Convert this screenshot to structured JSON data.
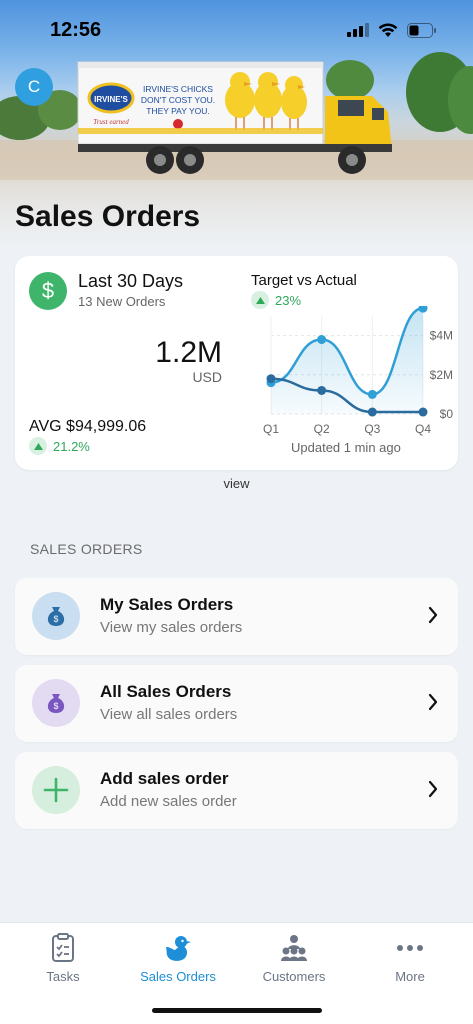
{
  "status_bar": {
    "time": "12:56"
  },
  "header": {
    "avatar_initial": "C",
    "title": "Sales Orders",
    "banner": {
      "brand": "IRVINE'S",
      "tagline_line1": "IRVINE'S CHICKS",
      "tagline_line2": "DON'T COST YOU.",
      "tagline_line3": "THEY PAY YOU.",
      "brand_sub": "Trust earned"
    }
  },
  "summary": {
    "period_title": "Last 30 Days",
    "period_sub": "13 New Orders",
    "total_value": "1.2M",
    "total_currency": "USD",
    "avg_label": "AVG $94,999.06",
    "avg_trend": "21.2%",
    "chart_title": "Target vs Actual",
    "chart_trend": "23%",
    "updated": "Updated 1 min ago",
    "view_label": "view"
  },
  "chart_data": {
    "type": "line",
    "categories": [
      "Q1",
      "Q2",
      "Q3",
      "Q4"
    ],
    "y_ticks": [
      "$0",
      "$2M",
      "$4M"
    ],
    "ylim": [
      0,
      5
    ],
    "series": [
      {
        "name": "",
        "values": [
          1.6,
          3.8,
          1.0,
          5.4
        ],
        "color": "#2f9fd6"
      },
      {
        "name": "",
        "values": [
          1.8,
          1.2,
          0.1,
          0.1
        ],
        "color": "#2b6c9e"
      }
    ],
    "grid": true
  },
  "section": {
    "heading": "SALES ORDERS",
    "items": [
      {
        "title": "My Sales Orders",
        "subtitle": "View my sales orders"
      },
      {
        "title": "All Sales Orders",
        "subtitle": "View all sales orders"
      },
      {
        "title": "Add sales order",
        "subtitle": "Add new sales order"
      }
    ]
  },
  "tabs": [
    {
      "label": "Tasks",
      "icon": "clipboard-icon"
    },
    {
      "label": "Sales Orders",
      "icon": "bird-icon",
      "active": true
    },
    {
      "label": "Customers",
      "icon": "customers-icon"
    },
    {
      "label": "More",
      "icon": "ellipsis-icon"
    }
  ],
  "colors": {
    "accent": "#1e8fd6",
    "positive": "#2fa85c",
    "my_orders_icon_bg": "#c9def0",
    "all_orders_icon_bg": "#e3dbf2",
    "add_order_icon_bg": "#d6eedd"
  }
}
